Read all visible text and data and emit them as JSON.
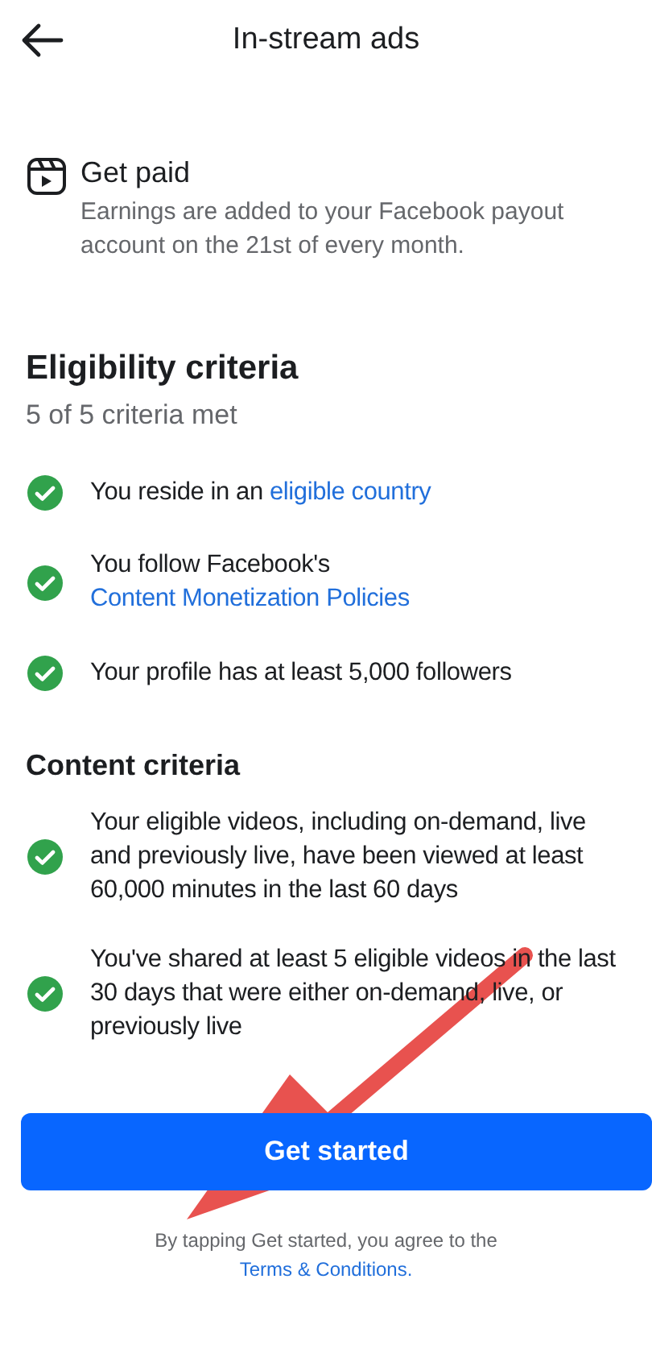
{
  "header": {
    "title": "In-stream ads"
  },
  "feature": {
    "title": "Get paid",
    "description": "Earnings are added to your Facebook payout account on the 21st of every month."
  },
  "eligibility": {
    "heading": "Eligibility criteria",
    "summary": "5 of 5 criteria met",
    "items": [
      {
        "text": "You reside in an ",
        "link": "eligible country",
        "met": true
      },
      {
        "text": "You follow Facebook's ",
        "link": "Content Monetization Policies",
        "met": true
      },
      {
        "text": "Your profile has at least 5,000 followers",
        "met": true
      }
    ]
  },
  "content_criteria": {
    "heading": "Content criteria",
    "items": [
      {
        "text": "Your eligible videos, including on-demand, live and previously live, have been viewed at least 60,000 minutes in the last 60 days",
        "met": true
      },
      {
        "text": "You've shared at least 5 eligible videos in the last 30 days that were either on-demand, live, or previously live",
        "met": true
      }
    ]
  },
  "primary_button": "Get started",
  "footer": {
    "text": "By tapping Get started, you agree to the",
    "link": "Terms & Conditions."
  },
  "annotation": {
    "kind": "arrow"
  }
}
